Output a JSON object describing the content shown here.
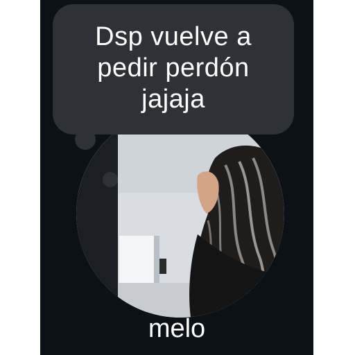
{
  "note": {
    "lines": [
      "Dsp vuelve a",
      "pedir perdón",
      "jajaja"
    ]
  },
  "profile": {
    "username": "melo"
  },
  "colors": {
    "background": "#0c1117",
    "bubble": "#2e3135",
    "text": "#ffffff"
  }
}
